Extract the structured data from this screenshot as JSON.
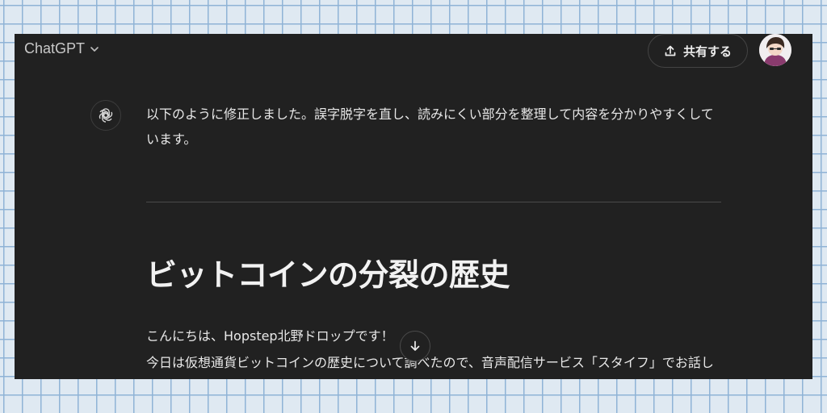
{
  "header": {
    "model_name": "ChatGPT",
    "share_label": "共有する"
  },
  "message": {
    "intro": "以下のように修正しました。誤字脱字を直し、読みにくい部分を整理して内容を分かりやすくしています。",
    "heading": "ビットコインの分裂の歴史",
    "paragraph_lines": [
      "こんにちは、Hopstep北野ドロップです！",
      "今日は仮想通貨ビットコインの歴史について調べたので、音声配信サービス「スタイフ」でお話し"
    ]
  },
  "icons": {
    "model_dropdown": "chevron-down-icon",
    "share": "upload-icon",
    "assistant": "openai-logo-icon",
    "scroll": "arrow-down-icon",
    "avatar": "user-avatar"
  },
  "colors": {
    "background": "#212121",
    "text": "#ececec",
    "grid_paper": "#dfe9f2"
  }
}
